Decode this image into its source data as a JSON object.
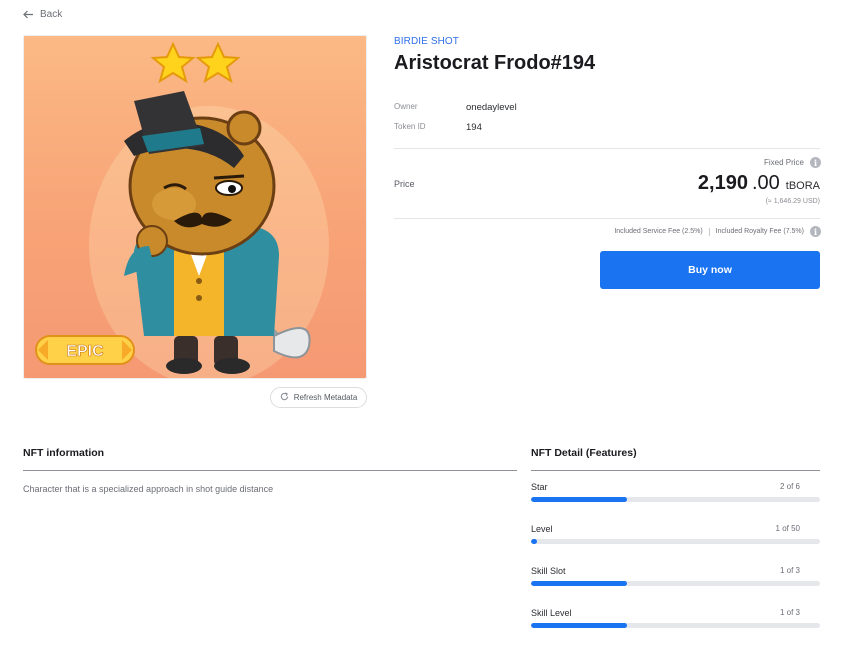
{
  "nav": {
    "back_label": "Back",
    "back_icon": "arrow-left-icon"
  },
  "item": {
    "collection": "BIRDIE SHOT",
    "title": "Aristocrat Frodo#194",
    "grade_badge": "EPIC",
    "stars_shown": 2
  },
  "meta": {
    "owner_label": "Owner",
    "owner_value": "onedaylevel",
    "token_label": "Token ID",
    "token_value": "194"
  },
  "price": {
    "fixed_label": "Fixed Price",
    "label": "Price",
    "integer": "2,190",
    "decimal": ".00",
    "currency": "tBORA",
    "usd": "(≈ 1,646.29 USD)"
  },
  "fees": {
    "service": "Included Service Fee (2.5%)",
    "royalty": "Included Royalty Fee (7.5%)"
  },
  "actions": {
    "buy_label": "Buy now",
    "refresh_label": "Refresh Metadata"
  },
  "info": {
    "title": "NFT information",
    "description": "Character that is a specialized approach in shot guide distance"
  },
  "detail": {
    "title": "NFT Detail (Features)",
    "features": [
      {
        "name": "Star",
        "value": "2 of 6",
        "fraction": 0.333
      },
      {
        "name": "Level",
        "value": "1 of 50",
        "fraction": 0.02
      },
      {
        "name": "Skill Slot",
        "value": "1 of 3",
        "fraction": 0.333
      },
      {
        "name": "Skill Level",
        "value": "1 of 3",
        "fraction": 0.333
      }
    ]
  },
  "colors": {
    "accent": "#1a73f0",
    "collection": "#2f6fe8",
    "art_bg": "#f8a377"
  }
}
